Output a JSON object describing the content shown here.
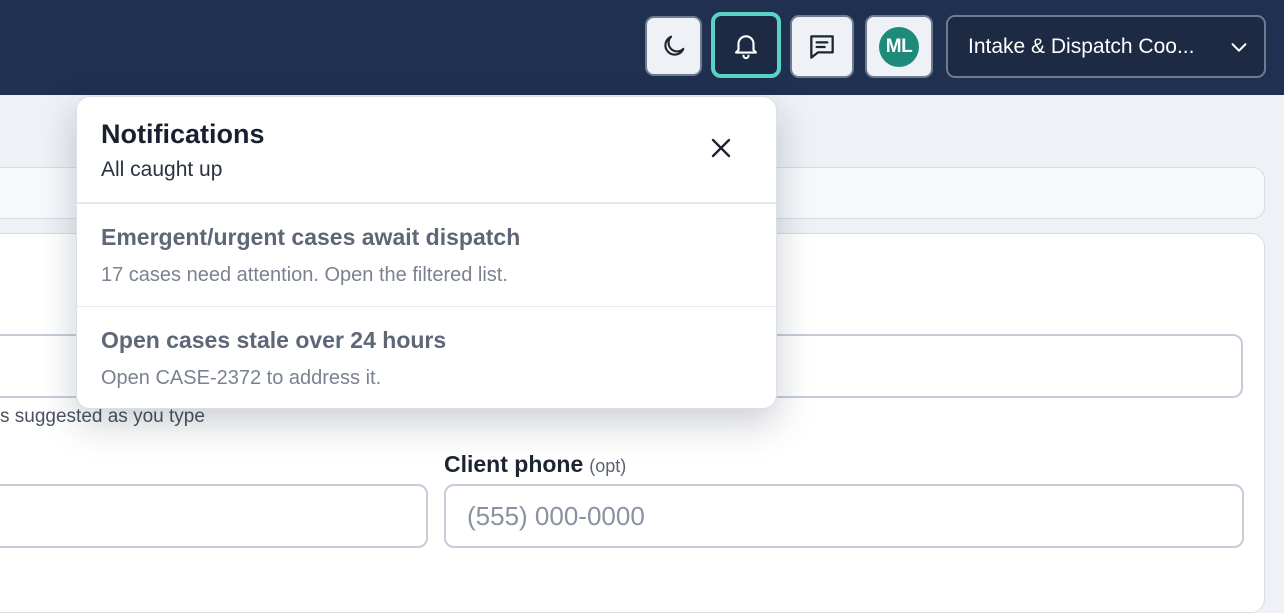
{
  "topbar": {
    "theme_icon": "moon-icon",
    "bell_icon": "bell-icon",
    "chat_icon": "message-square-icon",
    "avatar_initials": "ML",
    "role_select": "Intake & Dispatch Coo...",
    "chevron_icon": "chevron-down-icon"
  },
  "form": {
    "hint_text": "s suggested as you type",
    "phone_label": "Client phone",
    "phone_opt": "(opt)",
    "phone_placeholder": "(555) 000-0000",
    "phone_value": ""
  },
  "notifications": {
    "title": "Notifications",
    "subtitle": "All caught up",
    "close_icon": "close-icon",
    "items": [
      {
        "title": "Emergent/urgent cases await dispatch",
        "body": "17 cases need attention. Open the filtered list."
      },
      {
        "title": "Open cases stale over 24 hours",
        "body": "Open CASE-2372 to address it."
      }
    ]
  },
  "colors": {
    "topbar": "#1f3050",
    "accent_ring": "#5ad2c6",
    "avatar": "#1e8a7a"
  }
}
